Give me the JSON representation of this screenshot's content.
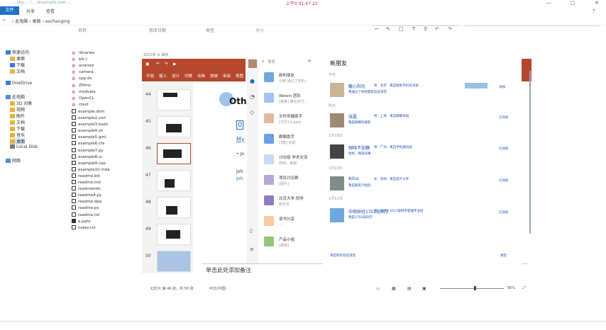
{
  "window": {
    "title": "…\\Ap… / …\\example.exe …",
    "clock": "上午0 01:47:22",
    "min_label": "—",
    "max_label": "□",
    "close_label": "✕"
  },
  "ribbon": {
    "file_tab": "文件",
    "tabs": [
      "共享",
      "查看"
    ]
  },
  "address": {
    "crumbs": "› 此电脑 › 桌面 › exchanging"
  },
  "toolbar": {
    "items": [
      "名称",
      "修改日期",
      "类型",
      "大小"
    ]
  },
  "sidebar": {
    "items": [
      {
        "label": "快速访问",
        "icon": "star-icon"
      },
      {
        "label": "桌面",
        "icon": "folder-icon"
      },
      {
        "label": "下载",
        "icon": "download-icon"
      },
      {
        "label": "文档",
        "icon": "folder-icon"
      },
      {
        "label": "OneDrive",
        "icon": "cloud-icon"
      },
      {
        "label": "此电脑",
        "icon": "computer-icon"
      },
      {
        "label": "3D 对象",
        "icon": "folder-icon"
      },
      {
        "label": "视频",
        "icon": "folder-icon"
      },
      {
        "label": "图片",
        "icon": "folder-icon"
      },
      {
        "label": "文档",
        "icon": "folder-icon"
      },
      {
        "label": "下载",
        "icon": "folder-icon"
      },
      {
        "label": "音乐",
        "icon": "folder-icon"
      },
      {
        "label": "桌面",
        "icon": "folder-icon"
      },
      {
        "label": "Local Disk",
        "icon": "drive-icon"
      },
      {
        "label": "网络",
        "icon": "network-icon"
      }
    ]
  },
  "files": [
    "libraries",
    "bfc.l",
    "android",
    "camera",
    "cpp-ds",
    "Zfilms",
    "modules",
    "OpenCL",
    "ctest",
    "example.dsm",
    "example2.cml",
    "example3.bash",
    "example4.sh",
    "example5.gml",
    "example6.cfa",
    "example7.py",
    "example8.ui",
    "example9.cpp",
    "example10.mda",
    "readme.bin",
    "readme.md",
    "readmeinfo",
    "readme4.py",
    "readme.dpa",
    "readme.py",
    "readme.txt",
    "a.pptx",
    "notes.txt"
  ],
  "powerpoint": {
    "recent": "2021年 ※ 保存",
    "menu": [
      "开始",
      "插入",
      "设计",
      "切换",
      "动画",
      "放映",
      "审阅",
      "视图"
    ],
    "slide_numbers": [
      "44",
      "45",
      "46",
      "47",
      "48",
      "49",
      "50"
    ],
    "slide_title": "Oth",
    "slide_bits": [
      "0",
      "My",
      "• Jo",
      "Joh",
      "Joh"
    ],
    "notes": "单击此处添加备注",
    "status_left": "幻灯片 第 46 张，共 50 张",
    "status_lang": "中文(中国)",
    "zoom": "90%"
  },
  "wechat": {
    "search_placeholder": "搜索",
    "chats": [
      {
        "name": "新的朋友",
        "msg": "小明 通过了你的…"
      },
      {
        "name": "Weixin 团队",
        "msg": "[链接] 微信支付…"
      },
      {
        "name": "文件传输助手",
        "msg": "[文件] a.pptx"
      },
      {
        "name": "群聊助手",
        "msg": "[3条] 好的"
      },
      {
        "name": "讨论组 学术交流",
        "msg": "收到，谢谢"
      },
      {
        "name": "项目讨论群",
        "msg": "[图片]"
      },
      {
        "name": "北京大学 同学",
        "msg": "明天见"
      },
      {
        "name": "读书分享",
        "msg": "…"
      },
      {
        "name": "产品小组",
        "msg": "[链接]"
      }
    ],
    "title": "新朋友",
    "sections": [
      "今天",
      "昨天",
      "1月18日",
      "1月15日",
      "1月12日"
    ],
    "friends": [
      {
        "name": "暖心阳光",
        "meta": "男 · 北京 · 来自搜索手机号添加",
        "desc": "我通过了你的朋友验证请求",
        "action": "添加"
      },
      {
        "name": "张磊",
        "meta": "男 · 上海 · 来自群聊添加",
        "desc": "我是群聊的朋友",
        "action": "已添加"
      },
      {
        "name": "咖啡不加糖",
        "meta": "男 · 广州 · 来自手机通讯录",
        "desc": "你好，我是同事",
        "action": "已添加"
      },
      {
        "name": "Ailsa",
        "meta": "女 · 深圳 · 来自名片分享",
        "desc": "我是朋友介绍的",
        "action": "已添加"
      },
      {
        "name": "中南财经1702班同学",
        "meta": "男 · 武汉 · 2017级财务管理专业班",
        "desc": "我是1702班同学",
        "action": "已添加"
      }
    ],
    "footer_left": "清空所有验证消息",
    "footer_right": "清空"
  }
}
